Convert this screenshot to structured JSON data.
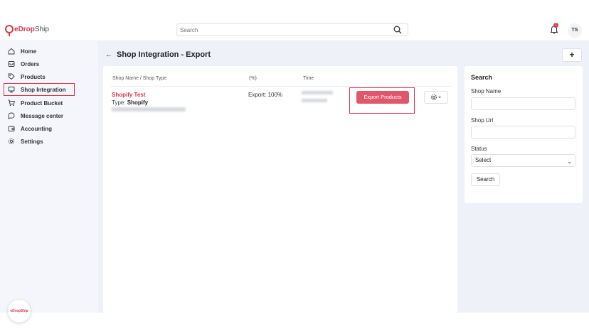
{
  "header": {
    "logo_e": "e",
    "logo_drop": "Drop",
    "logo_ship": "Ship",
    "search_placeholder": "Search",
    "notification_count": "1",
    "avatar_initials": "TS"
  },
  "sidebar": {
    "items": [
      {
        "label": "Home",
        "icon": "home-icon"
      },
      {
        "label": "Orders",
        "icon": "inbox-icon"
      },
      {
        "label": "Products",
        "icon": "tag-icon"
      },
      {
        "label": "Shop Integration",
        "icon": "monitor-icon",
        "active": true
      },
      {
        "label": "Product Bucket",
        "icon": "cart-icon"
      },
      {
        "label": "Message center",
        "icon": "chat-icon"
      },
      {
        "label": "Accounting",
        "icon": "wallet-icon"
      },
      {
        "label": "Settings",
        "icon": "gear-icon"
      }
    ],
    "help_label": "eDropShip"
  },
  "page": {
    "title": "Shop Integration - Export",
    "add_label": "+"
  },
  "table": {
    "headers": {
      "shop": "Shop Name  /  Shop Type",
      "percent": "(%)",
      "time": "Time"
    },
    "rows": [
      {
        "shop_name": "Shopify Test",
        "type_prefix": "Type: ",
        "type_value": "Shopify",
        "export": "Export: 100%",
        "action_label": "Export Products"
      }
    ]
  },
  "filters": {
    "title": "Search",
    "shop_name_label": "Shop Name",
    "shop_url_label": "Shop Url",
    "status_label": "Status",
    "status_selected": "Select",
    "search_button": "Search"
  },
  "colors": {
    "accent": "#d6374a",
    "button": "#e0566a",
    "background": "#eef1f7"
  }
}
